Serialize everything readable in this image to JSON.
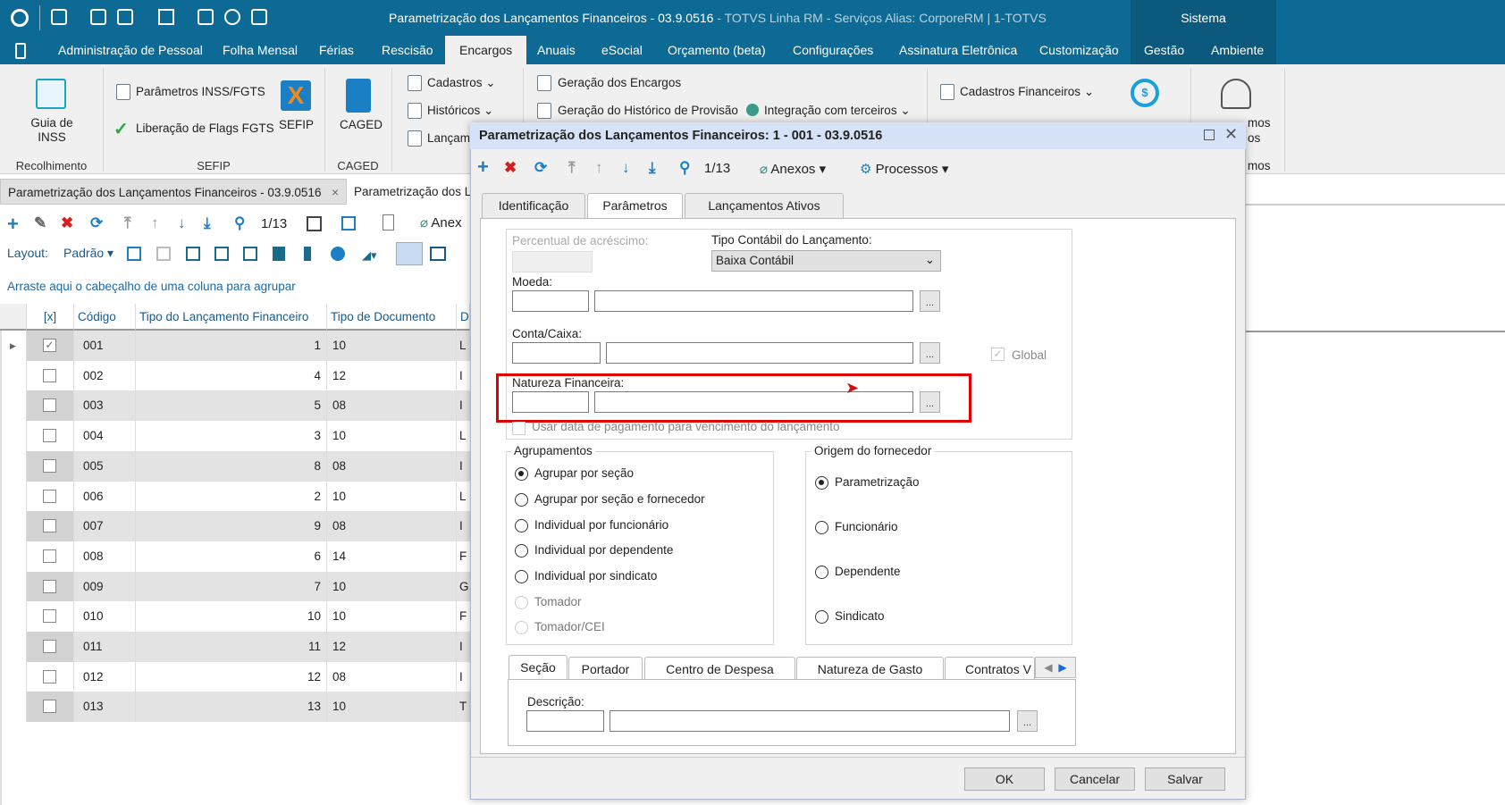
{
  "window": {
    "title": "Parametrização dos Lançamentos Financeiros - 03.9.0516",
    "subtitle": " - TOTVS Linha RM - Serviços  Alias: CorporeRM | 1-TOTVS",
    "sistema": "Sistema"
  },
  "menu": [
    "Administração de Pessoal",
    "Folha Mensal",
    "Férias",
    "Rescisão",
    "Encargos",
    "Anuais",
    "eSocial",
    "Orçamento (beta)",
    "Configurações",
    "Assinatura Eletrônica",
    "Customização",
    "Gestão",
    "Ambiente"
  ],
  "ribbon": {
    "guia": "Guia de INSS",
    "recolhimento": "Recolhimento",
    "param_inss": "Parâmetros INSS/FGTS",
    "lib_flags": "Liberação de Flags FGTS",
    "sefip": "SEFIP",
    "sefip_group": "SEFIP",
    "caged": "CAGED",
    "caged_group": "CAGED",
    "cadastros": "Cadastros",
    "historicos": "Históricos",
    "lancam": "Lançam",
    "geracao_encargos": "Geração dos Encargos",
    "geracao_hist": "Geração do Histórico de Provisão",
    "integracao": "Integração com terceiros",
    "cad_fin": "Cadastros Financeiros",
    "partial1": "mos",
    "partial2": "os",
    "partial3": "mos"
  },
  "doctabs": [
    "Parametrização dos Lançamentos Financeiros - 03.9.0516",
    "Parametrização dos L"
  ],
  "toolbar": {
    "counter": "1/13",
    "anexos": "Anex",
    "layout_label": "Layout:",
    "layout_value": "Padrão"
  },
  "grid": {
    "group_hint": "Arraste aqui o cabeçalho de uma coluna para agrupar",
    "columns": [
      "[x]",
      "Código",
      "Tipo do Lançamento Financeiro",
      "Tipo de Documento",
      "D"
    ],
    "rows": [
      {
        "checked": true,
        "codigo": "001",
        "tipo": "1",
        "doc": "10",
        "d": "L"
      },
      {
        "checked": false,
        "codigo": "002",
        "tipo": "4",
        "doc": "12",
        "d": "I"
      },
      {
        "checked": false,
        "codigo": "003",
        "tipo": "5",
        "doc": "08",
        "d": "I"
      },
      {
        "checked": false,
        "codigo": "004",
        "tipo": "3",
        "doc": "10",
        "d": "L"
      },
      {
        "checked": false,
        "codigo": "005",
        "tipo": "8",
        "doc": "08",
        "d": "I"
      },
      {
        "checked": false,
        "codigo": "006",
        "tipo": "2",
        "doc": "10",
        "d": "L"
      },
      {
        "checked": false,
        "codigo": "007",
        "tipo": "9",
        "doc": "08",
        "d": "I"
      },
      {
        "checked": false,
        "codigo": "008",
        "tipo": "6",
        "doc": "14",
        "d": "F"
      },
      {
        "checked": false,
        "codigo": "009",
        "tipo": "7",
        "doc": "10",
        "d": "G"
      },
      {
        "checked": false,
        "codigo": "010",
        "tipo": "10",
        "doc": "10",
        "d": "F"
      },
      {
        "checked": false,
        "codigo": "011",
        "tipo": "11",
        "doc": "12",
        "d": "I"
      },
      {
        "checked": false,
        "codigo": "012",
        "tipo": "12",
        "doc": "08",
        "d": "I"
      },
      {
        "checked": false,
        "codigo": "013",
        "tipo": "13",
        "doc": "10",
        "d": "T"
      }
    ]
  },
  "dialog": {
    "title": "Parametrização dos Lançamentos Financeiros: 1 - 001 - 03.9.0516",
    "counter": "1/13",
    "anexos": "Anexos",
    "processos": "Processos",
    "tabs": [
      "Identificação",
      "Parâmetros",
      "Lançamentos Ativos"
    ],
    "percentual_label": "Percentual de acréscimo:",
    "tipo_contabil_label": "Tipo Contábil do Lançamento:",
    "tipo_contabil_value": "Baixa Contábil",
    "moeda_label": "Moeda:",
    "conta_label": "Conta/Caixa:",
    "global_label": "Global",
    "natureza_label": "Natureza Financeira:",
    "usar_data_label": "Usar data de pagamento para vencimento do lançamento",
    "ellipsis": "...",
    "agrupamentos": {
      "title": "Agrupamentos",
      "options": [
        "Agrupar por seção",
        "Agrupar por seção e fornecedor",
        "Individual por funcionário",
        "Individual por dependente",
        "Individual por sindicato",
        "Tomador",
        "Tomador/CEI"
      ],
      "selected": 0
    },
    "origem": {
      "title": "Origem do fornecedor",
      "options": [
        "Parametrização",
        "Funcionário",
        "Dependente",
        "Sindicato"
      ],
      "selected": 0
    },
    "subtabs": [
      "Seção",
      "Portador",
      "Centro de Despesa",
      "Natureza de Gasto",
      "Contratos V"
    ],
    "descricao_label": "Descrição:",
    "buttons": {
      "ok": "OK",
      "cancel": "Cancelar",
      "save": "Salvar"
    }
  },
  "colors": {
    "brand": "#0d6a94",
    "highlight": "#e00000"
  }
}
